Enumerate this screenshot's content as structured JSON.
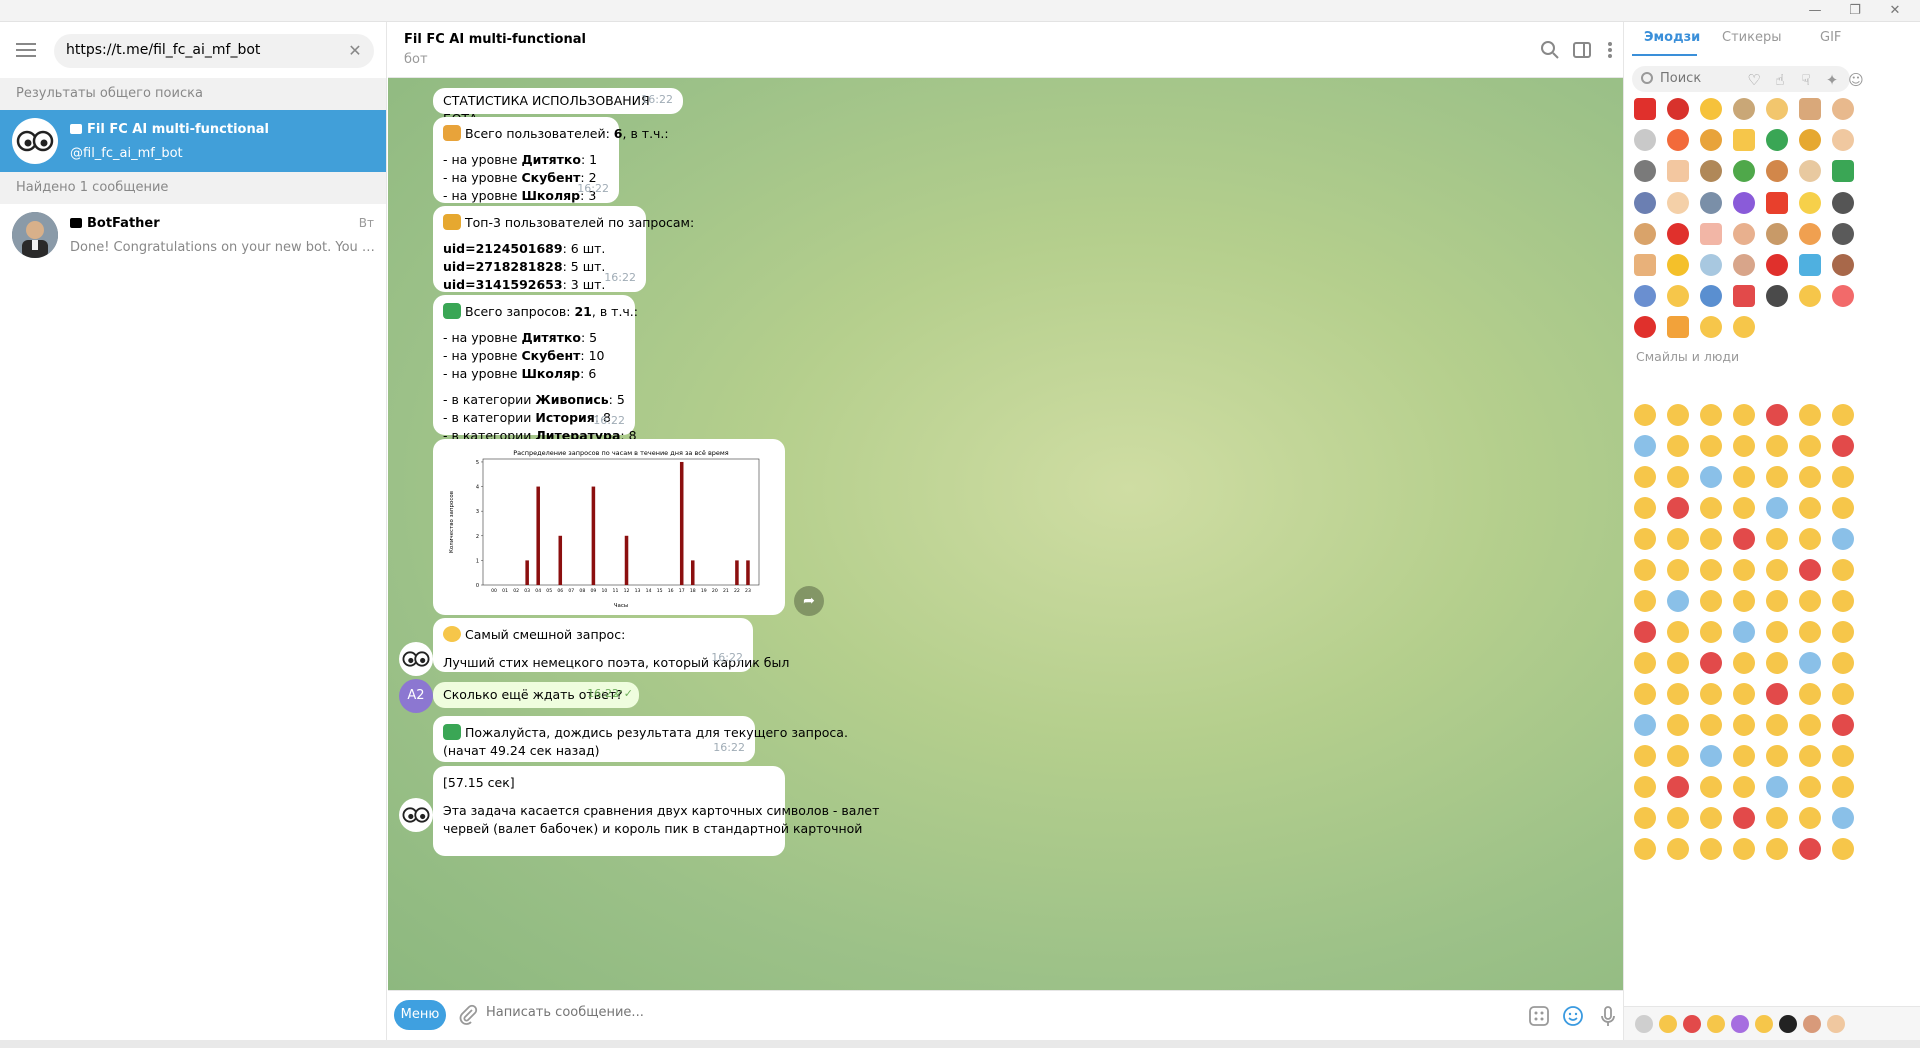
{
  "window": {
    "minimize": "—",
    "restore": "❐",
    "close": "✕"
  },
  "sidebar": {
    "search": {
      "value": "https://t.me/fil_fc_ai_mf_bot",
      "clear_icon": "close-icon"
    },
    "global_results_header": "Результаты общего поиска",
    "results": [
      {
        "title": "Fil FC AI multi-functional",
        "subtitle": "@fil_fc_ai_mf_bot",
        "active": true
      }
    ],
    "found_header": "Найдено 1 сообщение",
    "messages": [
      {
        "title": "BotFather",
        "date": "Вт",
        "preview": "Done! Congratulations on your new bot. You will fi..."
      }
    ]
  },
  "chat": {
    "title": "Fil FC AI multi-functional",
    "status": "бот",
    "bubbles": {
      "stats_header": {
        "text": "СТАТИСТИКА ИСПОЛЬЗОВАНИЯ БОТА",
        "time": "16:22"
      },
      "users": {
        "intro": "Всего пользователей: ",
        "intro_count": "6",
        "intro_tail": ", в т.ч.:",
        "lines": [
          {
            "prefix": "- на уровне ",
            "level": "Дитятко",
            "value": ": 1"
          },
          {
            "prefix": "- на уровне ",
            "level": "Скубент",
            "value": ": 2"
          },
          {
            "prefix": "- на уровне ",
            "level": "Школяр",
            "value": ": 3"
          }
        ],
        "time": "16:22"
      },
      "top3": {
        "intro": "Топ-3 пользователей по запросам:",
        "lines": [
          {
            "uid": "uid=2124501689",
            "value": ": 6 шт."
          },
          {
            "uid": "uid=2718281828",
            "value": ": 5 шт."
          },
          {
            "uid": "uid=3141592653",
            "value": ": 3 шт."
          }
        ],
        "time": "16:22"
      },
      "requests": {
        "intro": "Всего запросов: ",
        "intro_count": "21",
        "intro_tail": ", в т.ч.:",
        "levels": [
          {
            "prefix": "- на уровне ",
            "name": "Дитятко",
            "value": ": 5"
          },
          {
            "prefix": "- на уровне ",
            "name": "Скубент",
            "value": ": 10"
          },
          {
            "prefix": "- на уровне ",
            "name": "Школяр",
            "value": ": 6"
          }
        ],
        "categories": [
          {
            "prefix": "- в категории ",
            "name": "Живопись",
            "value": ": 5"
          },
          {
            "prefix": "- в категории ",
            "name": "История",
            "value": ": 8"
          },
          {
            "prefix": "- в категории ",
            "name": "Литература",
            "value": ": 8"
          }
        ],
        "time": "16:22"
      },
      "funniest": {
        "label": "Самый смешной запрос:",
        "text": "Лучший стих немецкого поэта, который карлик был",
        "time": "16:22"
      },
      "user_msg": {
        "avatar": "A2",
        "text": "Сколько ещё ждать ответ?",
        "time": "16:22",
        "checks": "✓✓"
      },
      "wait": {
        "text": "Пожалуйста, дождись результата для текущего запроса.",
        "detail": "(начат 49.24 сек назад)",
        "time": "16:22"
      },
      "answer": {
        "l1": "[57.15 сек]",
        "l2": "Эта задача касается сравнения двух карточных символов - валет",
        "l3": "червей (валет бабочек) и король пик в стандартной карточной"
      }
    },
    "composer": {
      "menu": "Меню",
      "placeholder": "Написать сообщение..."
    }
  },
  "chart_data": {
    "type": "bar",
    "title": "Распределение запросов по часам в течение дня за всё время",
    "xlabel": "Часы",
    "ylabel": "Количество запросов",
    "categories": [
      "00",
      "01",
      "02",
      "03",
      "04",
      "05",
      "06",
      "07",
      "08",
      "09",
      "10",
      "11",
      "12",
      "13",
      "14",
      "15",
      "16",
      "17",
      "18",
      "19",
      "20",
      "21",
      "22",
      "23"
    ],
    "values": [
      0,
      0,
      0,
      1,
      4,
      0,
      2,
      0,
      0,
      4,
      0,
      0,
      2,
      0,
      0,
      0,
      0,
      5,
      1,
      0,
      0,
      0,
      1,
      1
    ],
    "yticks": [
      0,
      1,
      2,
      3,
      4,
      5
    ],
    "ylim": [
      0,
      5
    ],
    "color": "#8b0f0f"
  },
  "emoji_panel": {
    "tabs": [
      "Эмодзи",
      "Стикеры",
      "GIF"
    ],
    "search_placeholder": "Поиск",
    "section_title": "Смайлы и люди",
    "recent_colors": [
      "#e0302c",
      "#d8322c",
      "#f6c23b",
      "#c9a777",
      "#f2c66d",
      "#d9a87a",
      "#e8b98d",
      "#c9c9c9",
      "#f26a3a",
      "#e8a33a",
      "#f6c64a",
      "#3aa655",
      "#e6a830",
      "#f0c8a0",
      "#7a7a7a",
      "#f3c7a0",
      "#b08858",
      "#4fa84a",
      "#d2874a",
      "#e8c9a0",
      "#3aa655",
      "#6b7fb2",
      "#f4d0a8",
      "#7a8fa8",
      "#8a5bd9",
      "#e8402c",
      "#f6d04a",
      "#555555",
      "#d9a36a",
      "#e0302c",
      "#f2b6a6",
      "#e8b08e",
      "#c89a68",
      "#f0a050",
      "#5a5a5a",
      "#e8b17a",
      "#f4c02a",
      "#a8c8e0",
      "#d8a58a",
      "#e0302c",
      "#4fb0e0",
      "#a8684a",
      "#6a8fd0",
      "#f6c64a",
      "#5a8fd0",
      "#e24a4a",
      "#4a4a4a",
      "#f6c64a",
      "#f26a6a",
      "#e0302c",
      "#f2a23a",
      "#f6c64a",
      "#f6c64a"
    ],
    "smiley_color": "#f6c64a"
  }
}
